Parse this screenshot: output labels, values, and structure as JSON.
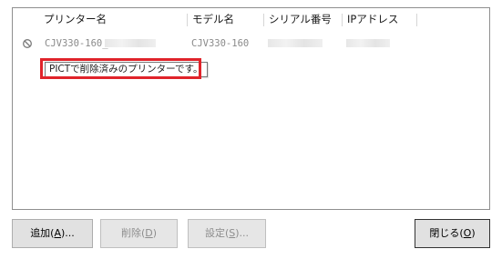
{
  "columns": {
    "printer_name": "プリンター名",
    "model_name": "モデル名",
    "serial_number": "シリアル番号",
    "ip_address": "IPアドレス"
  },
  "rows": [
    {
      "status_icon": "prohibited-icon",
      "printer_name": "CJV330-160_",
      "model_name": "CJV330-160",
      "serial_number": "",
      "ip_address": ""
    }
  ],
  "tooltip": {
    "text": "PICTで削除済みのプリンターです。"
  },
  "buttons": {
    "add": {
      "label": "追加(",
      "mnemonic": "A",
      "suffix": ")..."
    },
    "delete": {
      "label": "削除(",
      "mnemonic": "D",
      "suffix": ")"
    },
    "settings": {
      "label": "設定(",
      "mnemonic": "S",
      "suffix": ")..."
    },
    "close": {
      "label": "閉じる(",
      "mnemonic": "O",
      "suffix": ")"
    }
  },
  "colors": {
    "highlight": "#e0232a",
    "disabled_text": "#8d8d8d"
  }
}
